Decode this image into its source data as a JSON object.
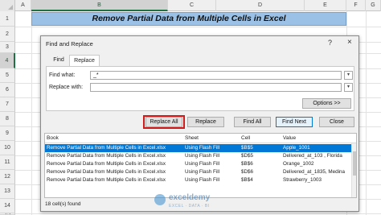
{
  "sheet": {
    "columns": [
      "A",
      "B",
      "C",
      "D",
      "E",
      "F",
      "G"
    ],
    "selected_column": "B",
    "rows": [
      "1",
      "2",
      "3",
      "4",
      "5",
      "6",
      "7",
      "8",
      "9",
      "10",
      "11",
      "12",
      "13",
      "14",
      "15"
    ],
    "selected_row": "4",
    "title_cell": "Remove Partial Data from Multiple Cells in Excel",
    "title_fill": "#9bc2e6"
  },
  "dialog": {
    "title": "Find and Replace",
    "help": "?",
    "close": "×",
    "tabs": [
      {
        "label": "Find",
        "active": false
      },
      {
        "label": "Replace",
        "active": true
      }
    ],
    "find_what_label": "Find what:",
    "find_what_value": "_*",
    "replace_with_label": "Replace with:",
    "replace_with_value": "",
    "options_label": "Options >>",
    "buttons": {
      "replace_all": "Replace All",
      "replace": "Replace",
      "find_all": "Find All",
      "find_next": "Find Next",
      "close": "Close"
    },
    "results": {
      "headers": [
        "Book",
        "Sheet",
        "Cell",
        "Value"
      ],
      "rows": [
        [
          "Remove Partial Data from Multiple Cells in Excel.xlsx",
          "Using Flash Fill",
          "$B$5",
          "Apple_1001"
        ],
        [
          "Remove Partial Data from Multiple Cells in Excel.xlsx",
          "Using Flash Fill",
          "$D$5",
          "Delivered_at_103 , Florida"
        ],
        [
          "Remove Partial Data from Multiple Cells in Excel.xlsx",
          "Using Flash Fill",
          "$B$6",
          "Orange_1002"
        ],
        [
          "Remove Partial Data from Multiple Cells in Excel.xlsx",
          "Using Flash Fill",
          "$D$6",
          "Delivered_at_1835, Medina"
        ],
        [
          "Remove Partial Data from Multiple Cells in Excel.xlsx",
          "Using Flash Fill",
          "$B$4",
          "Strawberry_1003"
        ]
      ],
      "selected_row": 0
    },
    "status": "18 cell(s) found"
  },
  "watermark": {
    "name": "exceldemy",
    "tagline": "EXCEL · DATA · BI"
  },
  "colors": {
    "accent": "#0078d7",
    "highlight_box": "#d11a1a",
    "excel_green": "#1f7244"
  }
}
